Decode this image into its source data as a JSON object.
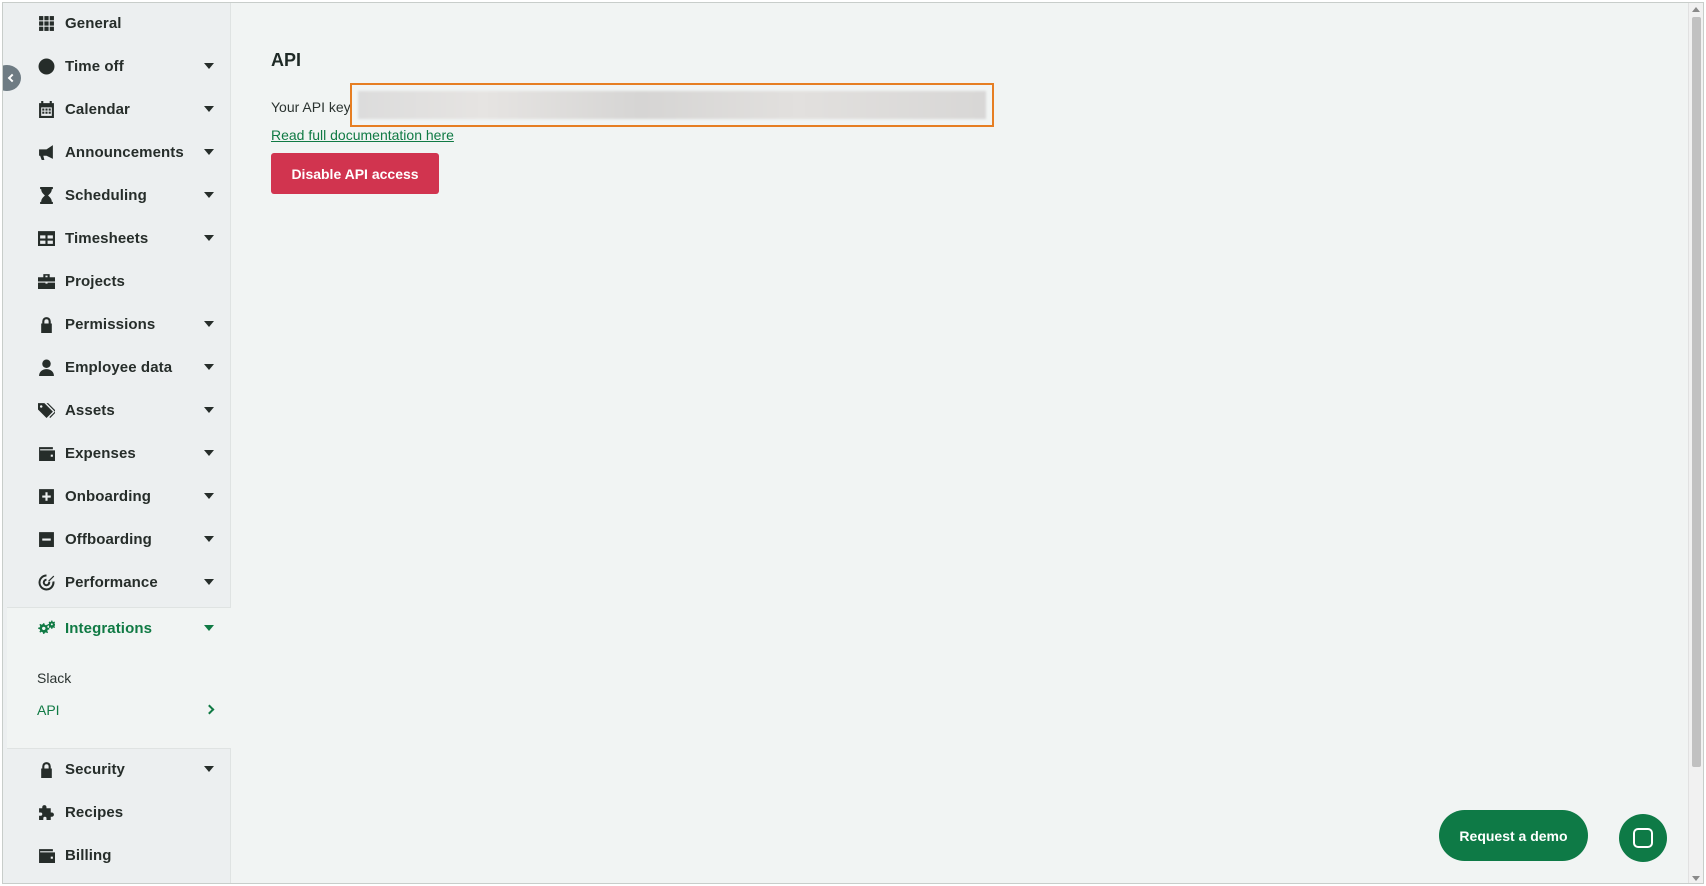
{
  "sidebar": {
    "items": [
      {
        "label": "General",
        "icon": "grid-icon",
        "caret": false
      },
      {
        "label": "Time off",
        "icon": "clock-icon",
        "caret": true
      },
      {
        "label": "Calendar",
        "icon": "calendar-icon",
        "caret": true
      },
      {
        "label": "Announcements",
        "icon": "megaphone-icon",
        "caret": true
      },
      {
        "label": "Scheduling",
        "icon": "hourglass-icon",
        "caret": true
      },
      {
        "label": "Timesheets",
        "icon": "table-icon",
        "caret": true
      },
      {
        "label": "Projects",
        "icon": "briefcase-icon",
        "caret": false
      },
      {
        "label": "Permissions",
        "icon": "lock-icon",
        "caret": true
      },
      {
        "label": "Employee data",
        "icon": "user-icon",
        "caret": true
      },
      {
        "label": "Assets",
        "icon": "tags-icon",
        "caret": true
      },
      {
        "label": "Expenses",
        "icon": "wallet-icon",
        "caret": true
      },
      {
        "label": "Onboarding",
        "icon": "plus-square-icon",
        "caret": true
      },
      {
        "label": "Offboarding",
        "icon": "minus-square-icon",
        "caret": true
      },
      {
        "label": "Performance",
        "icon": "target-icon",
        "caret": true
      }
    ],
    "active_group": {
      "label": "Integrations",
      "icon": "cogs-icon",
      "sub_items": [
        {
          "label": "Slack",
          "active": false
        },
        {
          "label": "API",
          "active": true
        }
      ]
    },
    "bottom_items": [
      {
        "label": "Security",
        "icon": "lock-icon",
        "caret": true
      },
      {
        "label": "Recipes",
        "icon": "puzzle-icon",
        "caret": false
      },
      {
        "label": "Billing",
        "icon": "wallet-icon",
        "caret": false
      }
    ]
  },
  "main": {
    "title": "API",
    "api_key_label": "Your API key:",
    "api_key_value": "",
    "doc_link": "Read full documentation here",
    "disable_button": "Disable API access"
  },
  "floating": {
    "demo_button": "Request a demo"
  },
  "colors": {
    "accent_green": "#107a44",
    "danger_red": "#d1344f",
    "highlight_orange": "#e67e22"
  }
}
